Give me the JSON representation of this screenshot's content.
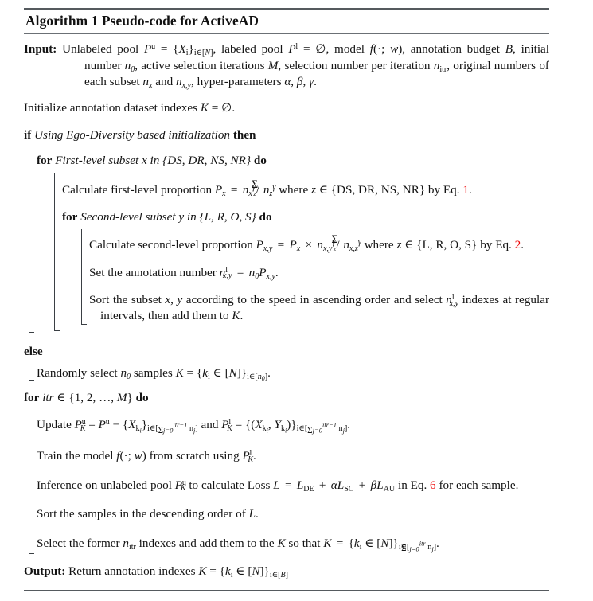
{
  "algorithm": {
    "title": "Algorithm 1 Pseudo-code for ActiveAD",
    "input_label": "Input:",
    "output_label": "Output:",
    "keywords": {
      "if": "if",
      "then": "then",
      "else": "else",
      "for": "for",
      "do": "do"
    },
    "input_text": "Unlabeled pool P^u = {X_i}_{i∈[N]}, labeled pool P^l = ∅, model f(·; w), annotation budget B, initial number n_0, active selection iterations M, selection number per iteration n_itr, original numbers of each subset n_x and n_x,y, hyper-parameters α, β, γ.",
    "initialize_text": "Initialize annotation dataset indexes K = ∅.",
    "if_condition": "Using Ego-Diversity based initialization",
    "for1_condition": "First-level subset x in {DS, DR, NS, NR}",
    "calc1_text": "Calculate first-level proportion P_x = n_x^γ / Σ_z n_z^γ where z ∈ {DS, DR, NS, NR} by Eq. 1.",
    "calc1_eqref": "1",
    "for2_condition": "Second-level subset y in {L, R, O, S}",
    "calc2_text": "Calculate second-level proportion P_x,y = P_x × n_x,y^γ / Σ_z n_x,z^γ where z ∈ {L, R, O, S} by Eq. 2.",
    "calc2_eqref": "2",
    "set_annotation_text": "Set the annotation number n^l_x,y = n_0 P_x,y.",
    "sort_subset_text": "Sort the subset x, y according to the speed in ascending order and select n^l_x,y indexes at regular intervals, then add them to K.",
    "else_text": "Randomly select n_0 samples K = {k_i ∈ [N]}_{i∈[n_0]}.",
    "for3_condition": "itr ∈ {1, 2, …, M}",
    "update_text": "Update P^u_K = P^u − {X_k_i}_{i∈[Σ_{j=0}^{itr−1} n_j]} and P^l_K = {(X_k_i, Y_k_i)}_{i∈[Σ_{j=0}^{itr−1} n_j]}.",
    "train_text": "Train the model f(·; w) from scratch using P^l_K.",
    "inference_text": "Inference on unlabeled pool P^u_K to calculate Loss L = L_DE + α L_SC + β L_AU in Eq. 6 for each sample.",
    "inference_eqref": "6",
    "sort_samples_text": "Sort the samples in the descending order of L.",
    "select_text": "Select the former n_itr indexes and add them to the K so that K = {k_i ∈ [N]}_{i∈[Σ_{j=0}^{itr} n_j]}.",
    "output_text": "Return annotation indexes K = {k_i ∈ [N]}_{i∈[B]}",
    "link_color": "#ee0000",
    "rule_color": "#555a5e",
    "text_color": "#141414"
  },
  "symbols": {
    "emptyset": "∅",
    "in": "∈",
    "times": "×",
    "minus": "−",
    "plus": "+",
    "equals": "=",
    "alpha": "α",
    "beta": "β",
    "gamma": "γ",
    "sum": "Σ",
    "dots": "…",
    "cdot": "·"
  },
  "fragments": {
    "f1": "Unlabeled pool",
    "f2": "labeled pool",
    "f3": "model",
    "f4": "annotation budget",
    "f5": "initial number",
    "f6": "active selection iterations",
    "f7": "selection number per iteration",
    "f8": "original numbers of each subset",
    "f9": "and",
    "f10": "hyper-parameters",
    "g1": "Initialize annotation dataset indexes",
    "h1": "Calculate first-level proportion",
    "h2": "where",
    "h3": "by Eq.",
    "i1": "Calculate second-level proportion",
    "j1": "Set the annotation number",
    "k1": "Sort the subset",
    "k2": "according to the speed in ascending order and select",
    "k3": "indexes at regular intervals, then add them to",
    "l1": "Randomly select",
    "l2": "samples",
    "m1": "Update",
    "m2": "and",
    "n1": "Train the model",
    "n2": "from scratch using",
    "o1": "Inference on unlabeled pool",
    "o2": "to calculate Loss",
    "o3": "in Eq.",
    "o4": "for each sample.",
    "p1": "Sort the samples in the descending order of",
    "q1": "Select the former",
    "q2": "indexes and add them to the",
    "q3": "so that",
    "r1": "Return annotation indexes"
  }
}
